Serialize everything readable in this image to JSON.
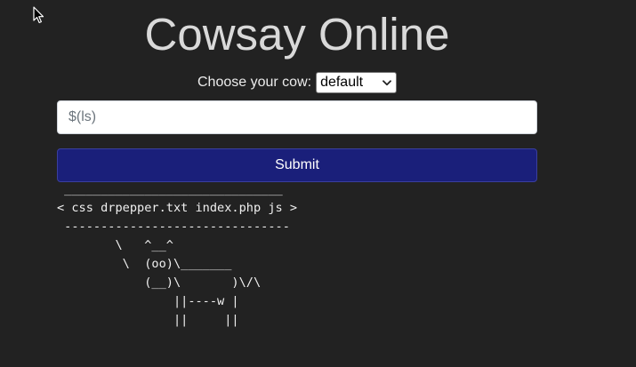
{
  "page": {
    "title": "Cowsay Online"
  },
  "form": {
    "choose_label": "Choose your cow:",
    "cow_select_value": "default",
    "message_value": "$(ls)",
    "submit_label": "Submit"
  },
  "output": {
    "cowsay_text": " ______________________________\n< css drpepper.txt index.php js >\n -------------------------------\n        \\   ^__^\n         \\  (oo)\\_______\n            (__)\\       )\\/\\\n                ||----w |\n                ||     ||"
  },
  "colors": {
    "background": "#222222",
    "title": "#d9d9d9",
    "submit_button": "#1a1f7a"
  },
  "icons": {
    "cursor": "mouse-pointer-icon",
    "select_arrow": "chevron-down-icon"
  }
}
